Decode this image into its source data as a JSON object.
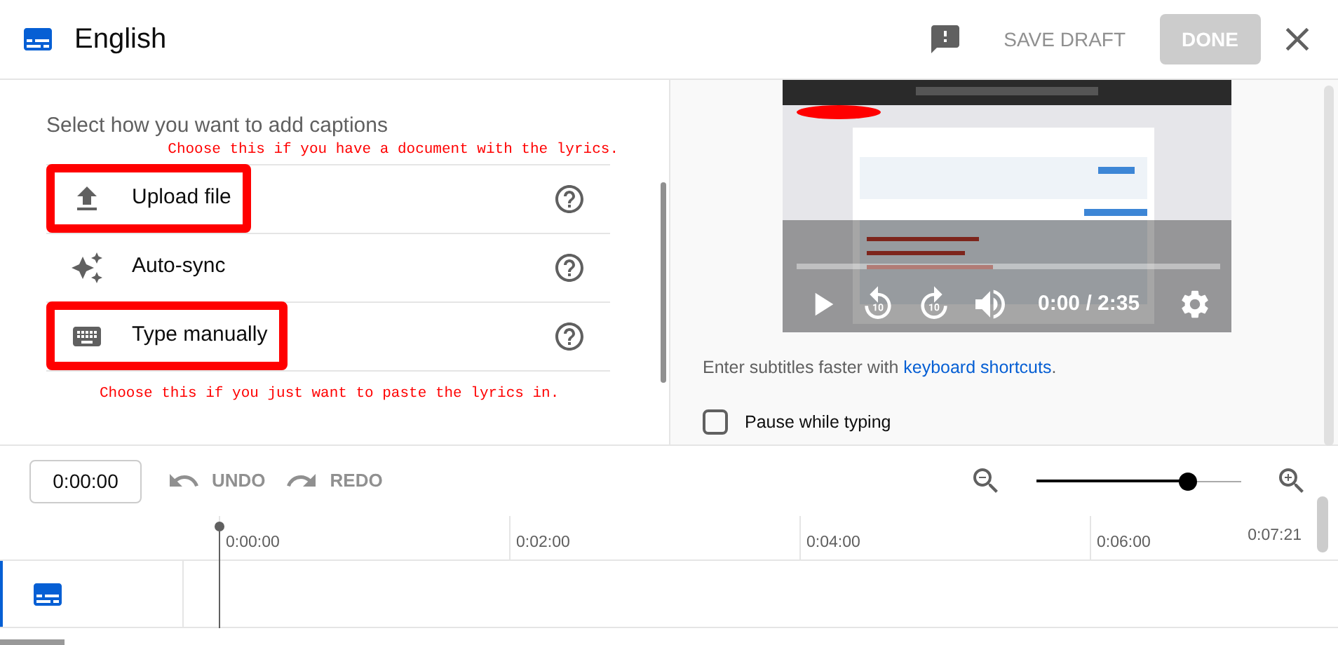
{
  "header": {
    "title": "English",
    "save_draft": "SAVE DRAFT",
    "done": {
      "label": "DONE",
      "disabled": true
    }
  },
  "captions_panel": {
    "prompt": "Select how you want to add captions",
    "options": [
      {
        "kind": "upload",
        "label": "Upload file",
        "highlighted": true,
        "note_above": "Choose this if you have a document with the lyrics."
      },
      {
        "kind": "autosync",
        "label": "Auto-sync",
        "highlighted": false
      },
      {
        "kind": "manual",
        "label": "Type manually",
        "highlighted": true,
        "note_below": "Choose this if you just want to paste the lyrics in."
      }
    ]
  },
  "player": {
    "time": "0:00 / 2:35",
    "tip": "Enter subtitles faster with ",
    "tip_link": "keyboard shortcuts",
    "tip_end": ".",
    "pause_while_typing": {
      "label": "Pause while typing",
      "checked": false
    }
  },
  "toolbar": {
    "time": "0:00:00",
    "undo": "UNDO",
    "redo": "REDO",
    "zoom": {
      "level": 0.74
    }
  },
  "timeline": {
    "ticks": [
      "0:00:00",
      "0:02:00",
      "0:04:00",
      "0:06:00"
    ],
    "end": "0:07:21"
  }
}
